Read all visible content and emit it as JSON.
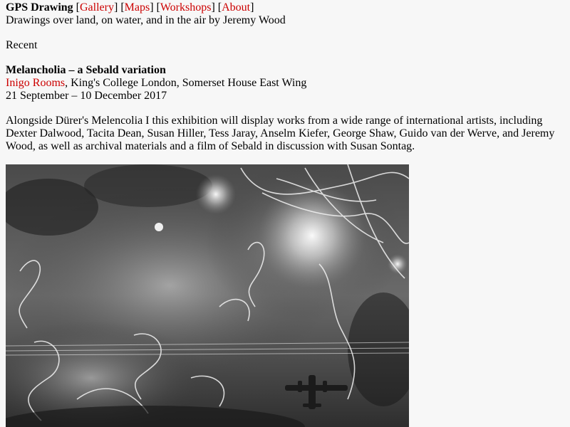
{
  "header": {
    "site_title": "GPS Drawing",
    "nav": [
      {
        "label": "Gallery"
      },
      {
        "label": "Maps"
      },
      {
        "label": "Workshops"
      },
      {
        "label": "About"
      }
    ],
    "tagline": "Drawings over land, on water, and in the air by Jeremy Wood"
  },
  "section_heading": "Recent",
  "exhibition": {
    "title": "Melancholia – a Sebald variation",
    "venue_link": "Inigo Rooms",
    "venue_rest": ", King's College London, Somerset House East Wing",
    "dates": "21 September – 10 December 2017",
    "description": "Alongside Dürer's Melencolia I this exhibition will display works from a wide range of international artists, including Dexter Dalwood, Tacita Dean, Susan Hiller, Tess Jaray, Anselm Kiefer, George Shaw, Guido van der Werve, and Jeremy Wood, as well as archival materials and a film of Sebald in discussion with Susan Sontag."
  },
  "colors": {
    "link": "#cc0000",
    "background": "#f7f7f7"
  }
}
